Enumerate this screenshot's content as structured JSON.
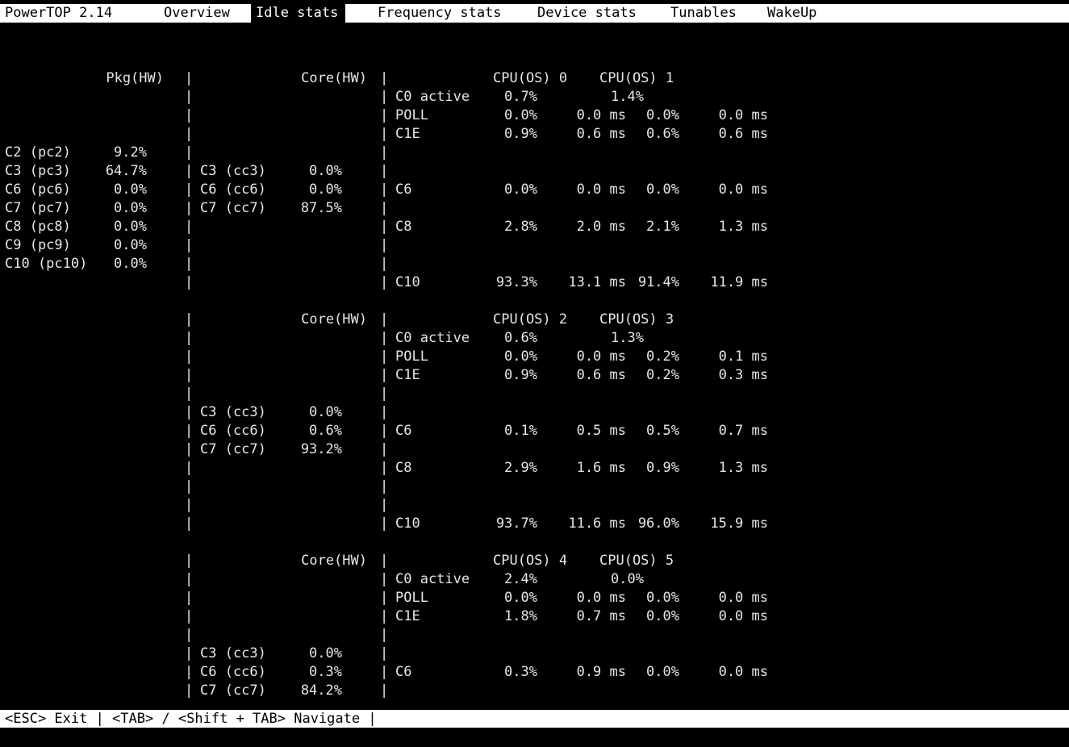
{
  "tabs": [
    {
      "label": "PowerTOP 2.14"
    },
    {
      "label": "Overview"
    },
    {
      "label": "Idle stats"
    },
    {
      "label": "Frequency stats"
    },
    {
      "label": "Device stats"
    },
    {
      "label": "Tunables"
    },
    {
      "label": "WakeUp"
    }
  ],
  "active_tab": "Idle stats",
  "separator": "|",
  "pkg": {
    "header": "Pkg(HW)",
    "states": [
      {
        "name": "C2 (pc2)",
        "value": "9.2%"
      },
      {
        "name": "C3 (pc3)",
        "value": "64.7%"
      },
      {
        "name": "C6 (pc6)",
        "value": "0.0%"
      },
      {
        "name": "C7 (pc7)",
        "value": "0.0%"
      },
      {
        "name": "C8 (pc8)",
        "value": "0.0%"
      },
      {
        "name": "C9 (pc9)",
        "value": "0.0%"
      },
      {
        "name": "C10 (pc10)",
        "value": "0.0%"
      }
    ]
  },
  "blocks": [
    {
      "core_header": "Core(HW)",
      "cpu_a": "CPU(OS) 0",
      "cpu_b": "CPU(OS) 1",
      "active": {
        "name": "C0 active",
        "a": "0.7%",
        "b": "1.4%"
      },
      "poll": {
        "name": "POLL",
        "a_pct": "0.0%",
        "a_ms": "0.0 ms",
        "b_pct": "0.0%",
        "b_ms": "0.0 ms"
      },
      "c1e": {
        "name": "C1E",
        "a_pct": "0.9%",
        "a_ms": "0.6 ms",
        "b_pct": "0.6%",
        "b_ms": "0.6 ms"
      },
      "core_states": [
        {
          "name": "C3 (cc3)",
          "value": "0.0%"
        },
        {
          "name": "C6 (cc6)",
          "value": "0.0%"
        },
        {
          "name": "C7 (cc7)",
          "value": "87.5%"
        }
      ],
      "c6": {
        "name": "C6",
        "a_pct": "0.0%",
        "a_ms": "0.0 ms",
        "b_pct": "0.0%",
        "b_ms": "0.0 ms"
      },
      "c8": {
        "name": "C8",
        "a_pct": "2.8%",
        "a_ms": "2.0 ms",
        "b_pct": "2.1%",
        "b_ms": "1.3 ms"
      },
      "c10": {
        "name": "C10",
        "a_pct": "93.3%",
        "a_ms": "13.1 ms",
        "b_pct": "91.4%",
        "b_ms": "11.9 ms"
      }
    },
    {
      "core_header": "Core(HW)",
      "cpu_a": "CPU(OS) 2",
      "cpu_b": "CPU(OS) 3",
      "active": {
        "name": "C0 active",
        "a": "0.6%",
        "b": "1.3%"
      },
      "poll": {
        "name": "POLL",
        "a_pct": "0.0%",
        "a_ms": "0.0 ms",
        "b_pct": "0.2%",
        "b_ms": "0.1 ms"
      },
      "c1e": {
        "name": "C1E",
        "a_pct": "0.9%",
        "a_ms": "0.6 ms",
        "b_pct": "0.2%",
        "b_ms": "0.3 ms"
      },
      "core_states": [
        {
          "name": "C3 (cc3)",
          "value": "0.0%"
        },
        {
          "name": "C6 (cc6)",
          "value": "0.6%"
        },
        {
          "name": "C7 (cc7)",
          "value": "93.2%"
        }
      ],
      "c6": {
        "name": "C6",
        "a_pct": "0.1%",
        "a_ms": "0.5 ms",
        "b_pct": "0.5%",
        "b_ms": "0.7 ms"
      },
      "c8": {
        "name": "C8",
        "a_pct": "2.9%",
        "a_ms": "1.6 ms",
        "b_pct": "0.9%",
        "b_ms": "1.3 ms"
      },
      "c10": {
        "name": "C10",
        "a_pct": "93.7%",
        "a_ms": "11.6 ms",
        "b_pct": "96.0%",
        "b_ms": "15.9 ms"
      }
    },
    {
      "core_header": "Core(HW)",
      "cpu_a": "CPU(OS) 4",
      "cpu_b": "CPU(OS) 5",
      "active": {
        "name": "C0 active",
        "a": "2.4%",
        "b": "0.0%"
      },
      "poll": {
        "name": "POLL",
        "a_pct": "0.0%",
        "a_ms": "0.0 ms",
        "b_pct": "0.0%",
        "b_ms": "0.0 ms"
      },
      "c1e": {
        "name": "C1E",
        "a_pct": "1.8%",
        "a_ms": "0.7 ms",
        "b_pct": "0.0%",
        "b_ms": "0.0 ms"
      },
      "core_states": [
        {
          "name": "C3 (cc3)",
          "value": "0.0%"
        },
        {
          "name": "C6 (cc6)",
          "value": "0.3%"
        },
        {
          "name": "C7 (cc7)",
          "value": "84.2%"
        }
      ],
      "c6": {
        "name": "C6",
        "a_pct": "0.3%",
        "a_ms": "0.9 ms",
        "b_pct": "0.0%",
        "b_ms": "0.0 ms"
      }
    }
  ],
  "footer": "<ESC> Exit | <TAB> / <Shift + TAB> Navigate |"
}
